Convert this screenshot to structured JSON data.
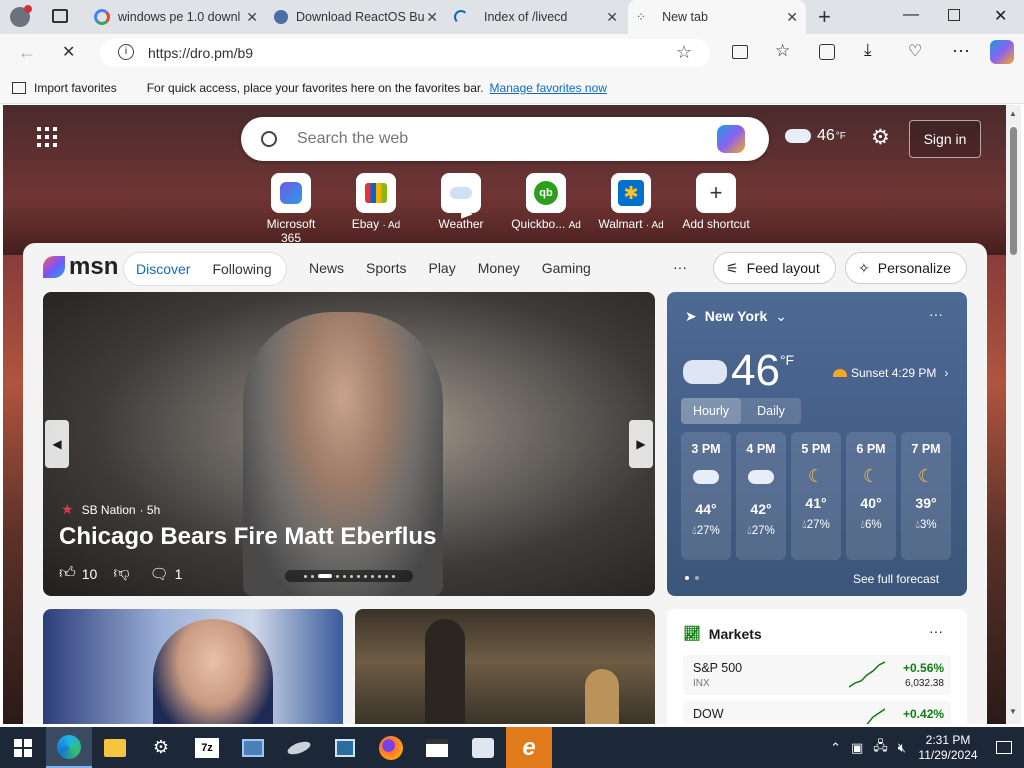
{
  "tabs": [
    {
      "title": "windows pe 1.0 downl",
      "icon": "google-icon",
      "active": false
    },
    {
      "title": "Download ReactOS Bu",
      "icon": "reactos-icon",
      "active": false
    },
    {
      "title": "Index of /livecd",
      "icon": "loading-icon",
      "active": false
    },
    {
      "title": "New tab",
      "icon": "edge-newtab-icon",
      "active": true
    }
  ],
  "address": {
    "url": "https://dro.pm/b9"
  },
  "favbar": {
    "import": "Import favorites",
    "hint": "For quick access, place your favorites here on the favorites bar.",
    "manage": "Manage favorites now"
  },
  "newtab": {
    "search_placeholder": "Search the web",
    "temp": "46",
    "temp_unit": "°F",
    "signin": "Sign in",
    "shortcuts": [
      {
        "label": "Microsoft 365",
        "ad": ""
      },
      {
        "label": "Ebay",
        "ad": "· Ad"
      },
      {
        "label": "Weather",
        "ad": ""
      },
      {
        "label": "Quickbo...",
        "ad": "Ad"
      },
      {
        "label": "Walmart",
        "ad": "· Ad"
      },
      {
        "label": "Add shortcut",
        "ad": ""
      }
    ]
  },
  "msn": {
    "logo": "msn",
    "tabs": [
      "Discover",
      "Following"
    ],
    "nav": [
      "News",
      "Sports",
      "Play",
      "Money",
      "Gaming"
    ],
    "more": "···",
    "feed_layout": "Feed layout",
    "personalize": "Personalize"
  },
  "hero": {
    "source": "SB Nation",
    "age": "· 5h",
    "title": "Chicago Bears Fire Matt Eberflus",
    "likes": "10",
    "comments": "1"
  },
  "weather": {
    "city": "New York",
    "temp": "46",
    "unit": "°F",
    "sunset": "Sunset 4:29 PM",
    "tabs": [
      "Hourly",
      "Daily"
    ],
    "hours": [
      {
        "time": "3 PM",
        "temp": "44°",
        "precip": "27%"
      },
      {
        "time": "4 PM",
        "temp": "42°",
        "precip": "27%"
      },
      {
        "time": "5 PM",
        "temp": "41°",
        "precip": "27%"
      },
      {
        "time": "6 PM",
        "temp": "40°",
        "precip": "6%"
      },
      {
        "time": "7 PM",
        "temp": "39°",
        "precip": "3%"
      }
    ],
    "forecast": "See full forecast"
  },
  "markets": {
    "title": "Markets",
    "rows": [
      {
        "name": "S&P 500",
        "ticker": "INX",
        "change": "+0.56%",
        "value": "6,032.38"
      },
      {
        "name": "DOW",
        "ticker": "",
        "change": "+0.42%",
        "value": ""
      }
    ]
  },
  "clock": {
    "time": "2:31 PM",
    "date": "11/29/2024"
  },
  "colors": {
    "accent": "#0f6cbd",
    "positive": "#107c10",
    "taskbar": "#1c2738"
  }
}
